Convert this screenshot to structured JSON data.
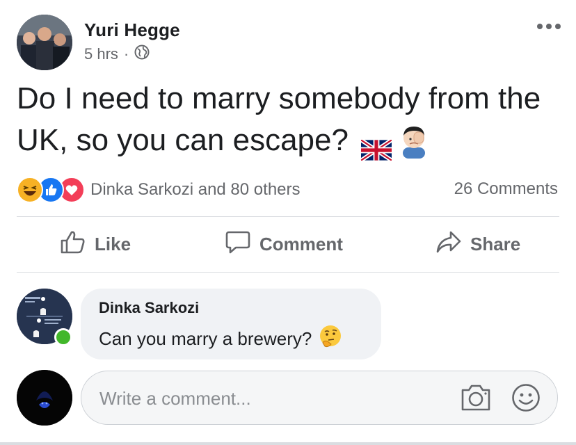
{
  "post": {
    "author": "Yuri Hegge",
    "time": "5 hrs",
    "separator": "·",
    "privacy_icon": "globe-icon",
    "text_line1": "Do I need to marry somebody from the",
    "text_line2": "UK, so you can escape?",
    "emojis": [
      "uk-flag",
      "facepalm"
    ]
  },
  "reactions": {
    "icons": [
      "haha",
      "like",
      "love"
    ],
    "summary": "Dinka Sarkozi and 80 others",
    "comments_count": "26 Comments"
  },
  "actions": {
    "like": "Like",
    "comment": "Comment",
    "share": "Share"
  },
  "comment": {
    "author": "Dinka Sarkozi",
    "text": "Can you marry a brewery?",
    "emoji": "thinking-face",
    "online": true
  },
  "composer": {
    "placeholder": "Write a comment..."
  },
  "colors": {
    "text_primary": "#1c1e21",
    "text_secondary": "#65676b",
    "like_blue": "#1877f2",
    "love_red": "#f33e58",
    "haha_yellow": "#f7b125",
    "online_green": "#42b72a",
    "bubble_bg": "#f0f2f5"
  }
}
